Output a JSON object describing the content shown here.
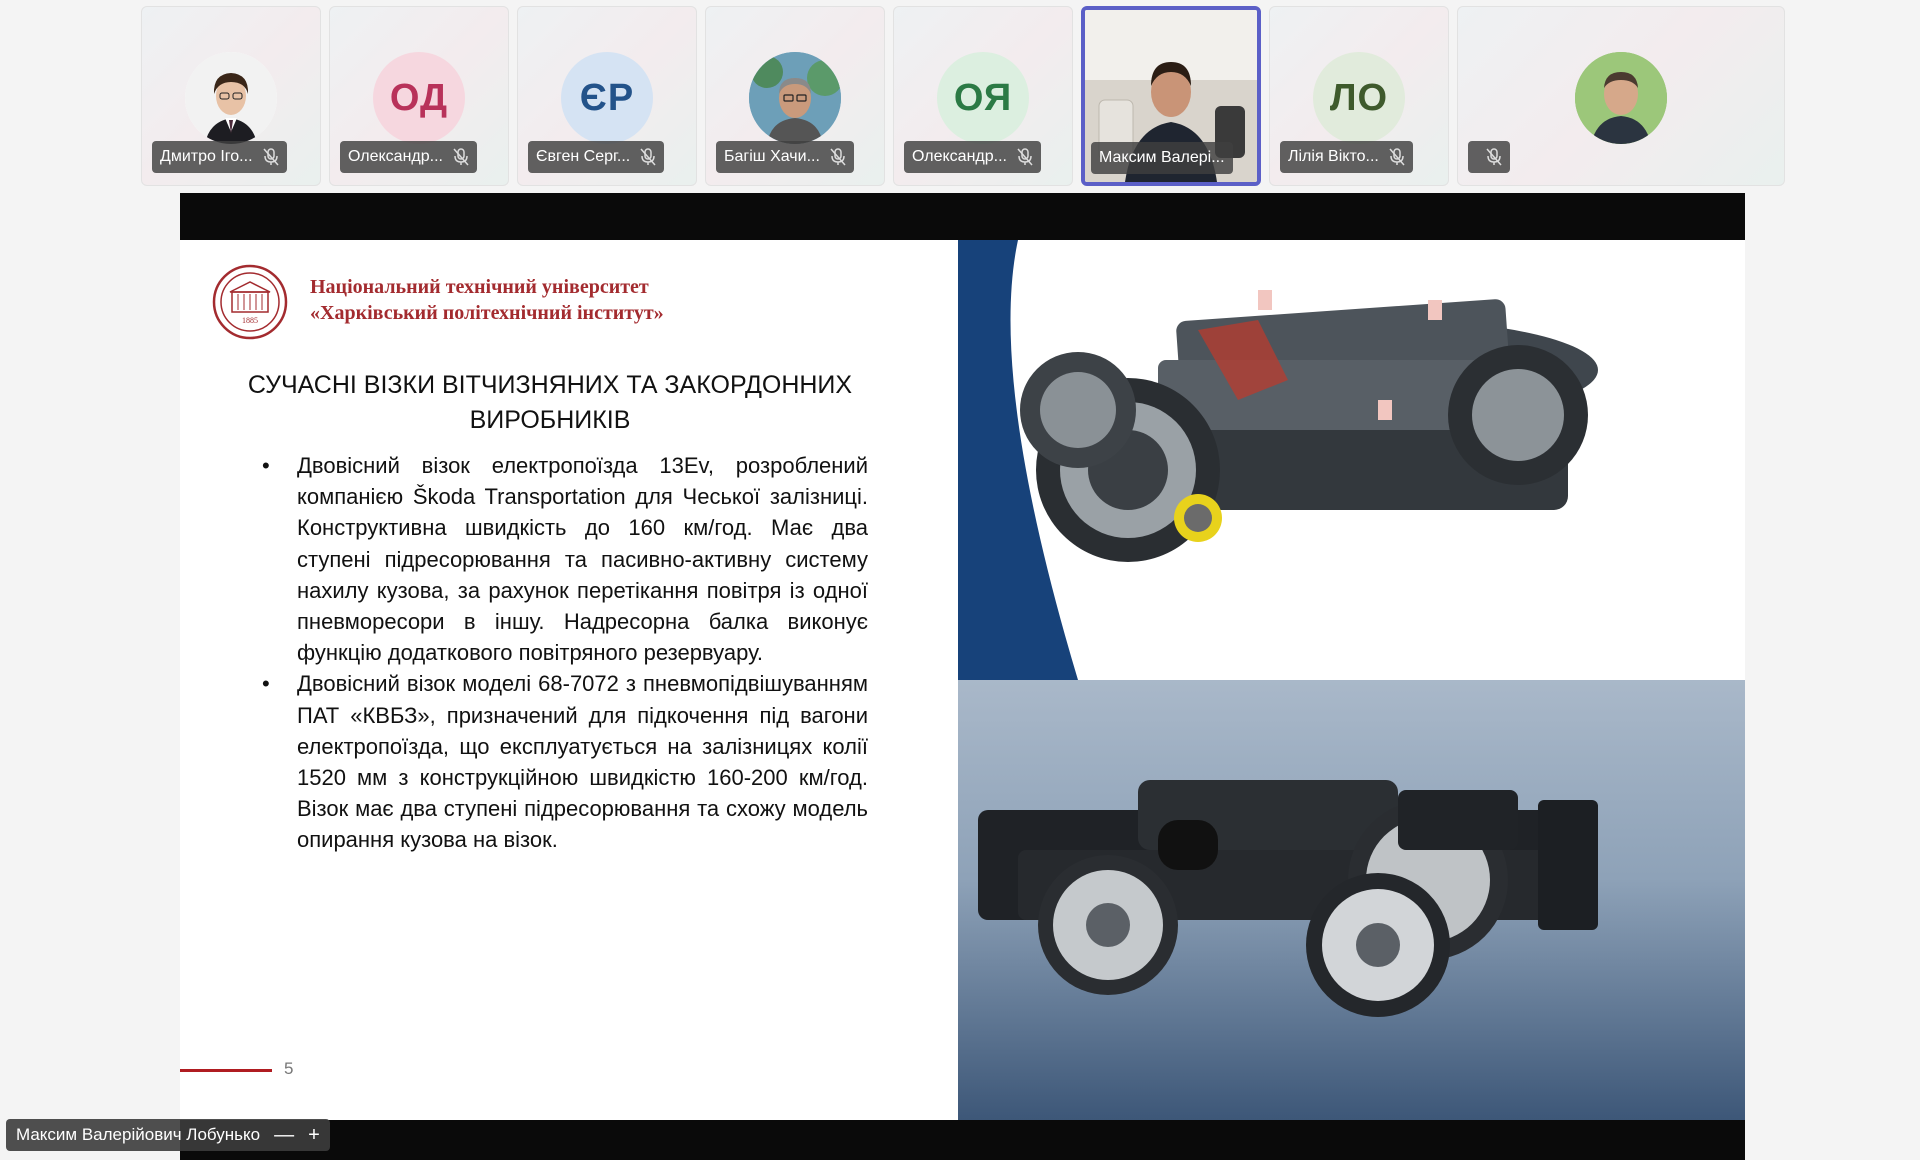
{
  "participants": [
    {
      "name": "Дмитро Іго...",
      "type": "photo",
      "muted": true
    },
    {
      "name": "Олександр...",
      "initials": "ОД",
      "type": "initials",
      "bg": "#f6d7df",
      "fg": "#b8325a",
      "muted": true
    },
    {
      "name": "Євген Серг...",
      "initials": "ЄР",
      "type": "initials",
      "bg": "#d5e3f3",
      "fg": "#23538a",
      "muted": true
    },
    {
      "name": "Багіш Хачи...",
      "type": "photo",
      "muted": true
    },
    {
      "name": "Олександр...",
      "initials": "ОЯ",
      "type": "initials",
      "bg": "#dcefe0",
      "fg": "#2b7a45",
      "muted": true
    },
    {
      "name": "Максим Валері...",
      "type": "video",
      "active": true,
      "muted": false
    },
    {
      "name": "Лілія Вікто...",
      "initials": "ЛО",
      "type": "initials",
      "bg": "#e1ebdc",
      "fg": "#3e5a2c",
      "muted": true
    },
    {
      "name": "",
      "type": "photo",
      "muted": true
    }
  ],
  "slide": {
    "university_line1": "Національний технічний університет",
    "university_line2": "«Харківський політехнічний інститут»",
    "logo_year": "1885",
    "heading_line1": "СУЧАСНІ ВІЗКИ ВІТЧИЗНЯНИХ ТА ЗАКОРДОННИХ",
    "heading_line2": "ВИРОБНИКІВ",
    "bullet_symbol": "•",
    "bullets": [
      "Двовісний візок електропоїзда 13Ev, розроблений компанією Škoda Transportation для Чеської залізниці. Конструктивна швидкість до 160 км/год. Має два ступені підресорювання та пасивно-активну систему нахилу кузова, за рахунок перетікання повітря із одної пневморесори в іншу. Надресорна балка виконує функцію додаткового повітряного резервуару.",
      "Двовісний візок моделі 68-7072 з пневмопідвішуванням ПАТ «КВБЗ», призначений для підкочення під вагони електропоїзда, що експлуатується на залізницях колії 1520 мм з конструкційною швидкістю 160-200 км/год. Візок має два ступені підресорювання та схожу модель опирання кузова на візок."
    ],
    "page_number": "5",
    "accent_color": "#a32b2f"
  },
  "presenter": {
    "name": "Максим Валерійович Лобунько",
    "minimize_label": "—",
    "expand_label": "+"
  }
}
